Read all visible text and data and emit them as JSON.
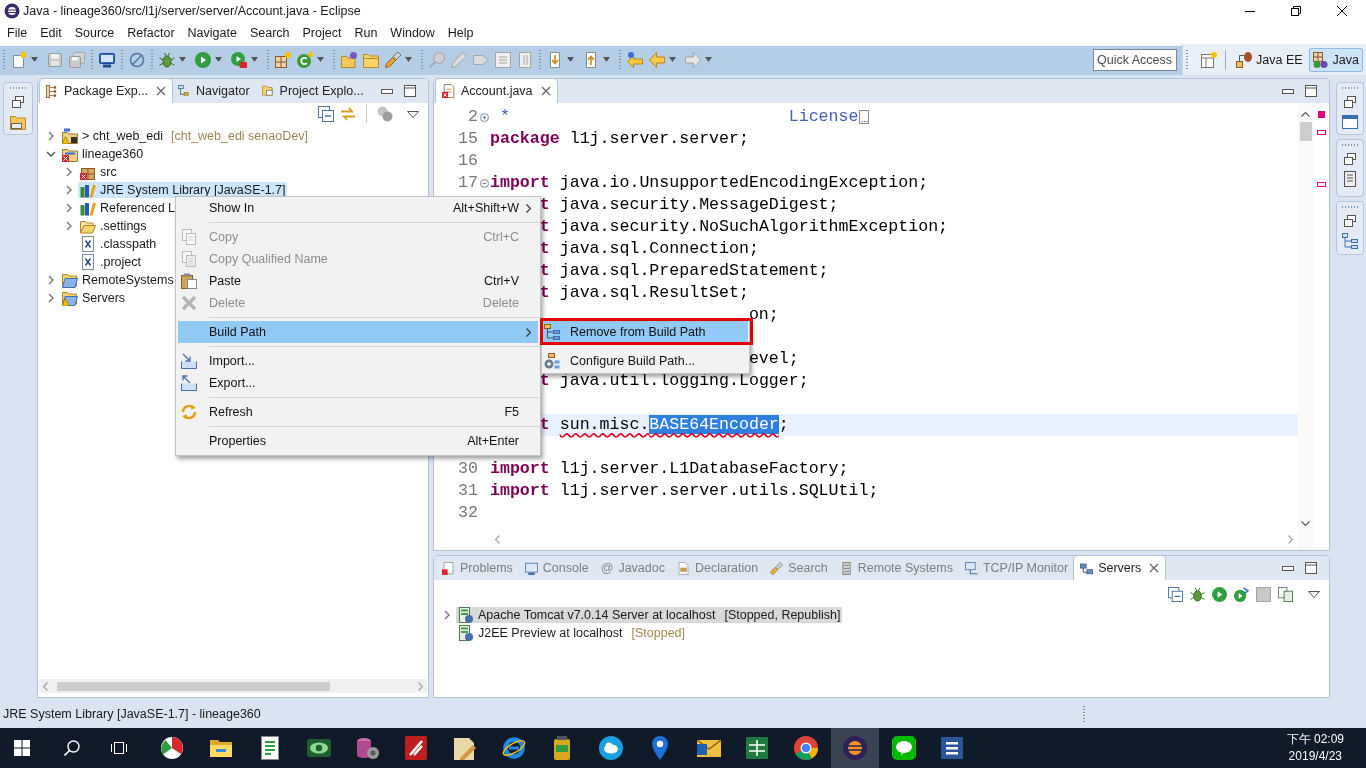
{
  "window": {
    "title": "Java - lineage360/src/l1j/server/server/Account.java - Eclipse"
  },
  "menu_bar": [
    "File",
    "Edit",
    "Source",
    "Refactor",
    "Navigate",
    "Search",
    "Project",
    "Run",
    "Window",
    "Help"
  ],
  "toolbar": {
    "quick_access": {
      "placeholder": "Quick Access"
    },
    "perspectives": [
      {
        "label": "Java EE",
        "selected": false
      },
      {
        "label": "Java",
        "selected": true
      }
    ]
  },
  "package_explorer": {
    "tabs": [
      {
        "label": "Package Exp...",
        "selected": true
      },
      {
        "label": "Navigator",
        "selected": false
      },
      {
        "label": "Project Explo...",
        "selected": false
      }
    ],
    "tree": [
      {
        "kind": "web_project",
        "label": "> cht_web_edi",
        "decoration": "[cht_web_edi senaoDev]",
        "expanded": false,
        "selected": false,
        "error": false,
        "warning": true
      },
      {
        "kind": "project",
        "label": "lineage360",
        "expanded": true,
        "selected": false,
        "error": true,
        "warning": false,
        "children": [
          {
            "kind": "source_folder",
            "label": "src",
            "expanded": false,
            "selected": false,
            "error": true,
            "warning": false
          },
          {
            "kind": "library",
            "label": "JRE System Library [JavaSE-1.7]",
            "expanded": false,
            "selected": true,
            "error": false,
            "warning": false
          },
          {
            "kind": "library",
            "label": "Referenced L",
            "expanded": false,
            "selected": false,
            "error": false,
            "warning": false
          },
          {
            "kind": "folder",
            "label": ".settings",
            "expanded": false,
            "selected": false,
            "error": false,
            "warning": false
          },
          {
            "kind": "xml_file",
            "label": ".classpath",
            "selected": false,
            "error": false,
            "warning": false
          },
          {
            "kind": "xml_file",
            "label": ".project",
            "selected": false,
            "error": false,
            "warning": false
          }
        ]
      },
      {
        "kind": "project_folder",
        "label": "RemoteSystems",
        "expanded": false,
        "selected": false,
        "error": false,
        "warning": false
      },
      {
        "kind": "project_folder",
        "label": "Servers",
        "expanded": false,
        "selected": false,
        "error": false,
        "warning": true
      }
    ]
  },
  "editor": {
    "tabs": [
      {
        "label": "Account.java",
        "selected": true,
        "error": true
      }
    ],
    "lines": [
      {
        "number": "2",
        "collapsed": true,
        "kind": "code",
        "current": false,
        "parts": [
          {
            "kind": "javadoc",
            "text": " *                            License"
          }
        ]
      },
      {
        "number": "15",
        "kind": "code",
        "current": false,
        "keyword": "package",
        "parts": [
          {
            "kind": "plain",
            "text": "l1j.server.server;"
          }
        ]
      },
      {
        "number": "16",
        "kind": "code",
        "current": false
      },
      {
        "number": "17",
        "collapsed": false,
        "kind": "code",
        "current": false,
        "keyword": "import",
        "parts": [
          {
            "kind": "plain",
            "text": "java.io.UnsupportedEncodingException;"
          }
        ]
      },
      {
        "kind": "behind_menu",
        "current": false,
        "keyword": "t",
        "parts": [
          {
            "kind": "plain",
            "text": "java.security.MessageDigest;"
          }
        ]
      },
      {
        "kind": "behind_menu",
        "current": false,
        "keyword": "t",
        "parts": [
          {
            "kind": "plain",
            "text": "java.security.NoSuchAlgorithmException;"
          }
        ]
      },
      {
        "kind": "behind_menu",
        "current": false,
        "keyword": "t",
        "parts": [
          {
            "kind": "plain",
            "text": "java.sql.Connection;"
          }
        ]
      },
      {
        "kind": "behind_menu",
        "current": false,
        "keyword": "t",
        "parts": [
          {
            "kind": "plain",
            "text": "java.sql.PreparedStatement;"
          }
        ]
      },
      {
        "kind": "behind_menu",
        "current": false,
        "keyword": "t",
        "parts": [
          {
            "kind": "plain",
            "text": "java.sql.ResultSet;"
          }
        ]
      },
      {
        "kind": "behind_submenu",
        "current": false,
        "parts": [
          {
            "kind": "plain",
            "text": "on;"
          }
        ]
      },
      {
        "kind": "behind_menu",
        "current": false
      },
      {
        "kind": "behind_submenu",
        "current": false,
        "parts": [
          {
            "kind": "plain",
            "text": "evel;"
          }
        ]
      },
      {
        "kind": "behind_menu",
        "current": false,
        "keyword": "t",
        "parts": [
          {
            "kind": "plain",
            "text": "java.util.logging.Logger;"
          }
        ]
      },
      {
        "kind": "behind_menu",
        "current": false
      },
      {
        "kind": "behind_menu",
        "current": true,
        "keyword": "t",
        "parts": [
          {
            "kind": "error",
            "text": "sun.misc."
          },
          {
            "kind": "error_selected",
            "text": "BASE64Encoder"
          },
          {
            "kind": "plain",
            "text": ";"
          }
        ]
      },
      {
        "kind": "behind_menu",
        "current": false
      },
      {
        "number": "30",
        "kind": "code",
        "current": false,
        "keyword": "import",
        "parts": [
          {
            "kind": "plain",
            "text": "l1j.server.L1DatabaseFactory;"
          }
        ]
      },
      {
        "number": "31",
        "kind": "code",
        "current": false,
        "keyword": "import",
        "parts": [
          {
            "kind": "plain",
            "text": "l1j.server.server.utils.SQLUtil;"
          }
        ]
      },
      {
        "number": "32",
        "kind": "code",
        "current": false
      }
    ]
  },
  "bottom_panel": {
    "tabs": [
      {
        "label": "Problems",
        "selected": false
      },
      {
        "label": "Console",
        "selected": false
      },
      {
        "glyph": "@",
        "label": "Javadoc",
        "selected": false
      },
      {
        "label": "Declaration",
        "selected": false
      },
      {
        "label": "Search",
        "selected": false
      },
      {
        "label": "Remote Systems",
        "selected": false
      },
      {
        "label": "TCP/IP Monitor",
        "selected": false
      },
      {
        "label": "Servers",
        "selected": true
      }
    ],
    "servers": [
      {
        "name": "Apache Tomcat v7.0.14 Server at localhost",
        "status": "[Stopped, Republish]",
        "expanded": false,
        "selected": true
      },
      {
        "name": "J2EE Preview at localhost",
        "status": "[Stopped]",
        "selected": false
      }
    ]
  },
  "context_menu": {
    "items": [
      {
        "kind": "item",
        "label": "Show In",
        "shortcut": "Alt+Shift+W",
        "submenu": true,
        "disabled": false,
        "selected": false
      },
      {
        "kind": "separator"
      },
      {
        "kind": "item",
        "label": "Copy",
        "shortcut": "Ctrl+C",
        "submenu": false,
        "disabled": true,
        "selected": false
      },
      {
        "kind": "item",
        "label": "Copy Qualified Name",
        "submenu": false,
        "disabled": true,
        "selected": false
      },
      {
        "kind": "item",
        "label": "Paste",
        "shortcut": "Ctrl+V",
        "submenu": false,
        "disabled": false,
        "selected": false
      },
      {
        "kind": "item",
        "label": "Delete",
        "shortcut": "Delete",
        "submenu": false,
        "disabled": true,
        "selected": false
      },
      {
        "kind": "separator"
      },
      {
        "kind": "item",
        "label": "Build Path",
        "submenu": true,
        "disabled": false,
        "selected": true
      },
      {
        "kind": "separator"
      },
      {
        "kind": "item",
        "label": "Import...",
        "submenu": false,
        "disabled": false,
        "selected": false
      },
      {
        "kind": "item",
        "label": "Export...",
        "submenu": false,
        "disabled": false,
        "selected": false
      },
      {
        "kind": "separator"
      },
      {
        "kind": "item",
        "label": "Refresh",
        "shortcut": "F5",
        "submenu": false,
        "disabled": false,
        "selected": false
      },
      {
        "kind": "separator"
      },
      {
        "kind": "item",
        "label": "Properties",
        "shortcut": "Alt+Enter",
        "submenu": false,
        "disabled": false,
        "selected": false
      }
    ]
  },
  "build_path_submenu": {
    "items": [
      {
        "label": "Remove from Build Path",
        "selected": true,
        "outlined": true
      },
      {
        "label": "Configure Build Path...",
        "selected": false,
        "outlined": false
      }
    ]
  },
  "status_bar": {
    "text": "JRE System Library [JavaSE-1.7] - lineage360"
  },
  "taskbar": {
    "apps": [
      {
        "active": false
      },
      {
        "active": false
      },
      {
        "active": false
      },
      {
        "active": false
      },
      {
        "active": false
      },
      {
        "active": false
      },
      {
        "active": false
      },
      {
        "active": false
      },
      {
        "active": false
      },
      {
        "active": false
      },
      {
        "active": false
      },
      {
        "active": false
      },
      {
        "active": false
      },
      {
        "active": false
      },
      {
        "active": true
      },
      {
        "active": false
      },
      {
        "active": false
      }
    ],
    "time": "下午 02:09",
    "date": "2019/4/23"
  }
}
